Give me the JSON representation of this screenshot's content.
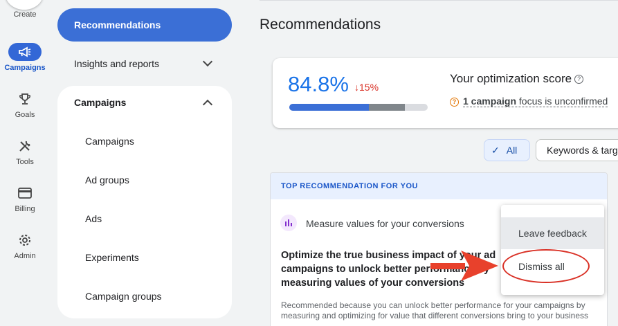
{
  "rail": {
    "create_label": "Create",
    "items": [
      {
        "label": "Campaigns",
        "icon": "megaphone-icon"
      },
      {
        "label": "Goals",
        "icon": "trophy-icon"
      },
      {
        "label": "Tools",
        "icon": "tools-icon"
      },
      {
        "label": "Billing",
        "icon": "credit-card-icon"
      },
      {
        "label": "Admin",
        "icon": "gear-icon"
      }
    ]
  },
  "nav": {
    "recommendations": "Recommendations",
    "insights": "Insights and reports",
    "campaigns_group": "Campaigns",
    "sub_items": [
      "Campaigns",
      "Ad groups",
      "Ads",
      "Experiments",
      "Campaign groups"
    ]
  },
  "main": {
    "title": "Recommendations",
    "score": {
      "value": "84.8%",
      "delta": "15%",
      "heading": "Your optimization score",
      "warning_link": "1 campaign",
      "warning_text": " focus is unconfirmed",
      "progress_fraction": 0.848
    },
    "filters": {
      "all": "All",
      "keywords": "Keywords & targeting"
    },
    "top_rec": {
      "banner": "TOP RECOMMENDATION FOR YOU",
      "type_label": "Measure values for your conversions",
      "headline": "Optimize the true business impact of your ad campaigns to unlock better performance by measuring values of your conversions",
      "why": "Recommended because you can unlock better performance for your campaigns by measuring and optimizing for value that different conversions bring to your business"
    },
    "menu": {
      "leave_feedback": "Leave feedback",
      "dismiss_all": "Dismiss all"
    }
  },
  "colors": {
    "primary": "#3b6fd6",
    "negative": "#d93025",
    "warning": "#e37400",
    "annotation": "#e8412c"
  }
}
